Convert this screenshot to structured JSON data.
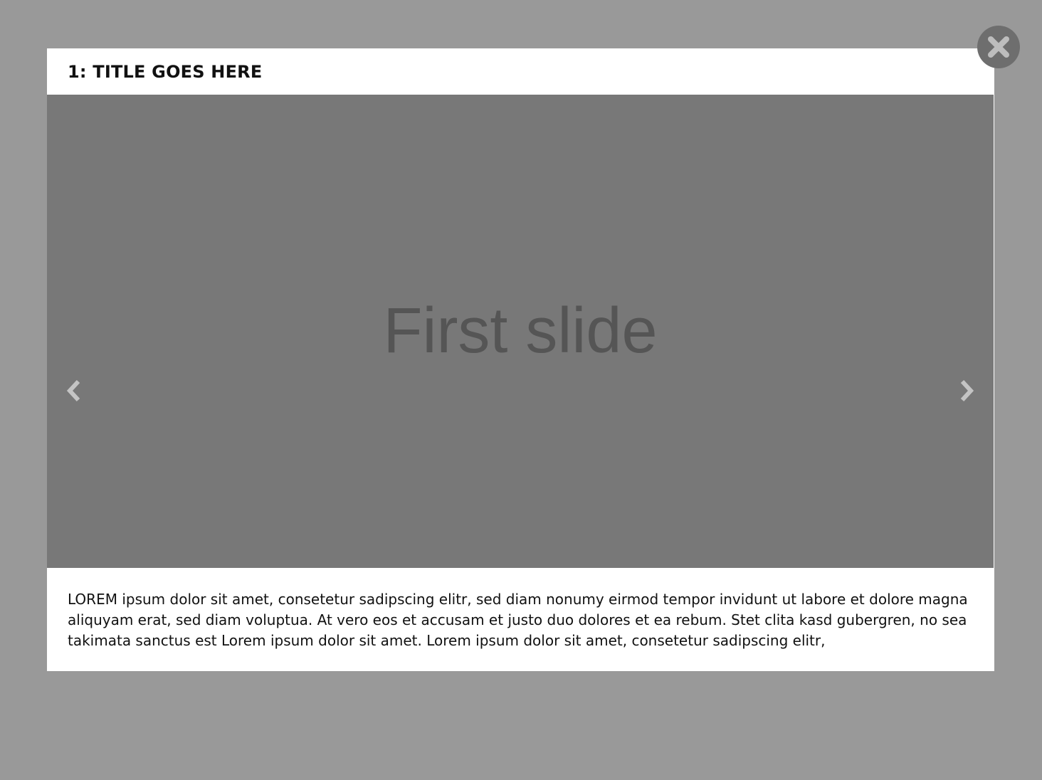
{
  "modal": {
    "title": "1: TITLE GOES HERE",
    "body_text": "LOREM ipsum dolor sit amet, consetetur sadipscing elitr, sed diam nonumy eirmod tempor invidunt ut labore et dolore magna aliquyam erat, sed diam voluptua. At vero eos et accusam et justo duo dolores et ea rebum. Stet clita kasd gubergren, no sea takimata sanctus est Lorem ipsum dolor sit amet. Lorem ipsum dolor sit amet, consetetur sadipscing elitr,"
  },
  "carousel": {
    "slide_label": "First slide",
    "prev_icon": "chevron-left-icon",
    "next_icon": "chevron-right-icon"
  },
  "close_button": {
    "icon": "close-icon"
  },
  "colors": {
    "backdrop": "#999999",
    "slide_background": "#787878",
    "slide_text": "#555555",
    "close_button": "#6e6e6e"
  }
}
